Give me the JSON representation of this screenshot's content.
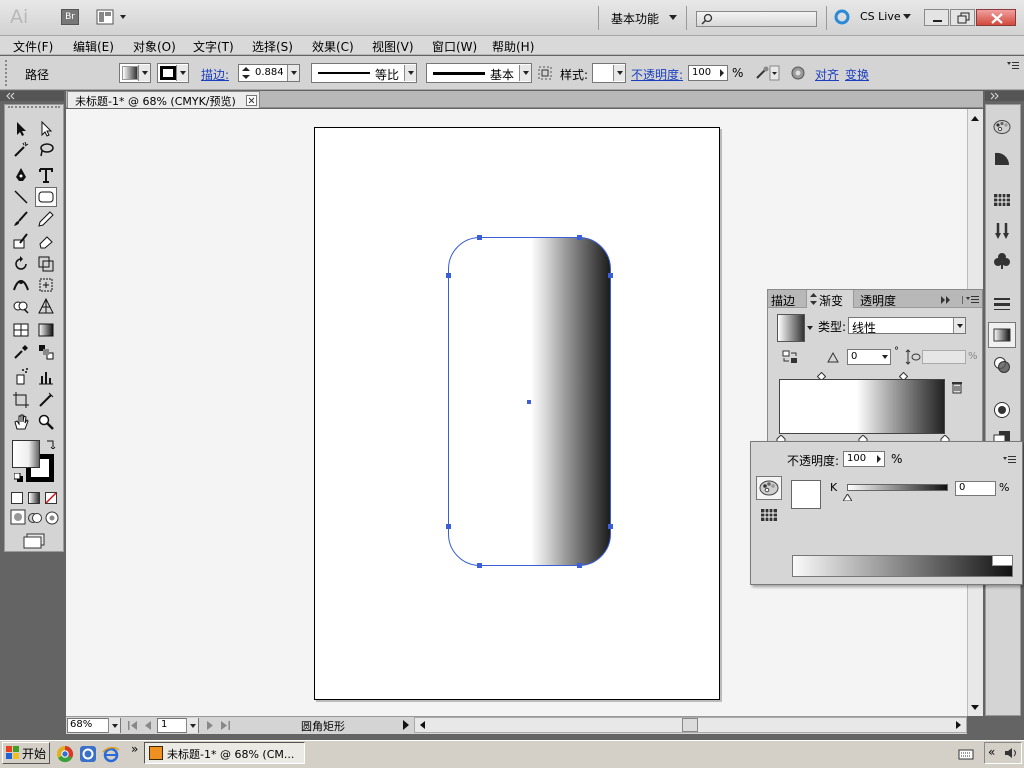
{
  "app": {
    "logo": "Ai",
    "bridge_label": "Br",
    "workspace": "基本功能",
    "cs_live": "CS Live"
  },
  "menu": [
    "文件(F)",
    "编辑(E)",
    "对象(O)",
    "文字(T)",
    "选择(S)",
    "效果(C)",
    "视图(V)",
    "窗口(W)",
    "帮助(H)"
  ],
  "control": {
    "object_type": "路径",
    "stroke_label": "描边:",
    "stroke_value": "0.884",
    "profile_label": "等比",
    "brush_label": "基本",
    "style_label": "样式:",
    "opacity_label": "不透明度:",
    "opacity_value": "100",
    "opacity_unit": "%",
    "align_label": "对齐",
    "transform_label": "变换"
  },
  "document": {
    "tab_title": "未标题-1* @ 68% (CMYK/预览)"
  },
  "gradient_panel": {
    "tabs": [
      "描边",
      "渐变",
      "透明度"
    ],
    "type_label": "类型:",
    "type_value": "线性",
    "angle_value": "0",
    "angle_unit": "°",
    "percent_unit": "%"
  },
  "color_panel": {
    "opacity_label": "不透明度:",
    "opacity_value": "100",
    "opacity_unit": "%",
    "channel_label": "K",
    "channel_value": "0",
    "channel_unit": "%"
  },
  "status": {
    "zoom": "68%",
    "page": "1",
    "tool_info": "圆角矩形"
  },
  "taskbar": {
    "start": "开始",
    "task_title": "未标题-1* @ 68% (CM...",
    "more": "»"
  },
  "colors": {
    "accent": "#3a5fd8",
    "panel_bg": "#d6d6d6",
    "canvas_bg": "#f4f4f4"
  }
}
